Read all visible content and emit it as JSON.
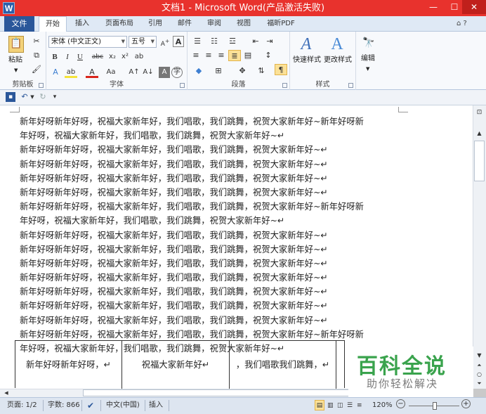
{
  "window": {
    "app_icon": "W",
    "title": "文档1 - Microsoft Word(产品激活失败)",
    "controls": {
      "minimize": "—",
      "maximize": "☐",
      "close": "✕"
    }
  },
  "tabs": {
    "file": "文件",
    "items": [
      "开始",
      "插入",
      "页面布局",
      "引用",
      "邮件",
      "审阅",
      "视图",
      "福昕PDF"
    ],
    "active": "开始",
    "help_icons": "⌂ ?"
  },
  "ribbon": {
    "clipboard": {
      "label": "剪贴板",
      "paste": "粘贴",
      "cut_icon": "scissors-icon",
      "copy_icon": "copy-icon",
      "format_painter_icon": "brush-icon"
    },
    "font": {
      "label": "字体",
      "font_name": "宋体 (中文正文)",
      "font_size": "五号",
      "phonetic": "wén",
      "buttons": [
        "B",
        "I",
        "U",
        "abc",
        "x₂",
        "x²"
      ],
      "color_buttons": [
        "A",
        "ab",
        "A",
        "Aa",
        "A↑",
        "A↓",
        "A",
        "字"
      ]
    },
    "paragraph": {
      "label": "段落"
    },
    "styles": {
      "label": "样式",
      "quick_styles": "快速样式",
      "change_styles": "更改样式"
    },
    "editing": {
      "label": "编辑",
      "button": "编辑"
    }
  },
  "qat": {
    "save_icon": "save-icon",
    "undo_icon": "undo-icon",
    "redo_icon": "redo-icon",
    "customize": "▾"
  },
  "document": {
    "lines": [
      "新年好呀新年好呀，祝福大家新年好，我们唱歌，我们跳舞，祝贺大家新年好~新年好呀新",
      "年好呀，祝福大家新年好，我们唱歌，我们跳舞，祝贺大家新年好~↵",
      "新年好呀新年好呀，祝福大家新年好，我们唱歌，我们跳舞，祝贺大家新年好~↵",
      "新年好呀新年好呀，祝福大家新年好，我们唱歌，我们跳舞，祝贺大家新年好~↵",
      "新年好呀新年好呀，祝福大家新年好，我们唱歌，我们跳舞，祝贺大家新年好~↵",
      "新年好呀新年好呀，祝福大家新年好，我们唱歌，我们跳舞，祝贺大家新年好~↵",
      "新年好呀新年好呀，祝福大家新年好，我们唱歌，我们跳舞，祝贺大家新年好~新年好呀新",
      "年好呀，祝福大家新年好，我们唱歌，我们跳舞，祝贺大家新年好~↵",
      "新年好呀新年好呀，祝福大家新年好，我们唱歌，我们跳舞，祝贺大家新年好~↵",
      "新年好呀新年好呀，祝福大家新年好，我们唱歌，我们跳舞，祝贺大家新年好~↵",
      "新年好呀新年好呀，祝福大家新年好，我们唱歌，我们跳舞，祝贺大家新年好~↵",
      "新年好呀新年好呀，祝福大家新年好，我们唱歌，我们跳舞，祝贺大家新年好~↵",
      "新年好呀新年好呀，祝福大家新年好，我们唱歌，我们跳舞，祝贺大家新年好~↵",
      "新年好呀新年好呀，祝福大家新年好，我们唱歌，我们跳舞，祝贺大家新年好~↵",
      "新年好呀新年好呀，祝福大家新年好，我们唱歌，我们跳舞，祝贺大家新年好~↵",
      "新年好呀新年好呀，祝福大家新年好，我们唱歌，我们跳舞，祝贺大家新年好~新年好呀新",
      "年好呀，祝福大家新年好，我们唱歌，我们跳舞，祝贺大家新年好~↵"
    ],
    "table_cells": [
      "新年好呀新年好呀，↵",
      "祝福大家新年好↵",
      "，我们唱歌我们跳舞，↵"
    ]
  },
  "watermark": {
    "title": "百科全说",
    "subtitle": "助你轻松解决"
  },
  "status": {
    "page": "页面: 1/2",
    "words": "字数: 866",
    "proof_icon": "proofing-icon",
    "language": "中文(中国)",
    "mode": "插入",
    "zoom": "120%",
    "zoom_out": "−",
    "zoom_in": "+"
  }
}
